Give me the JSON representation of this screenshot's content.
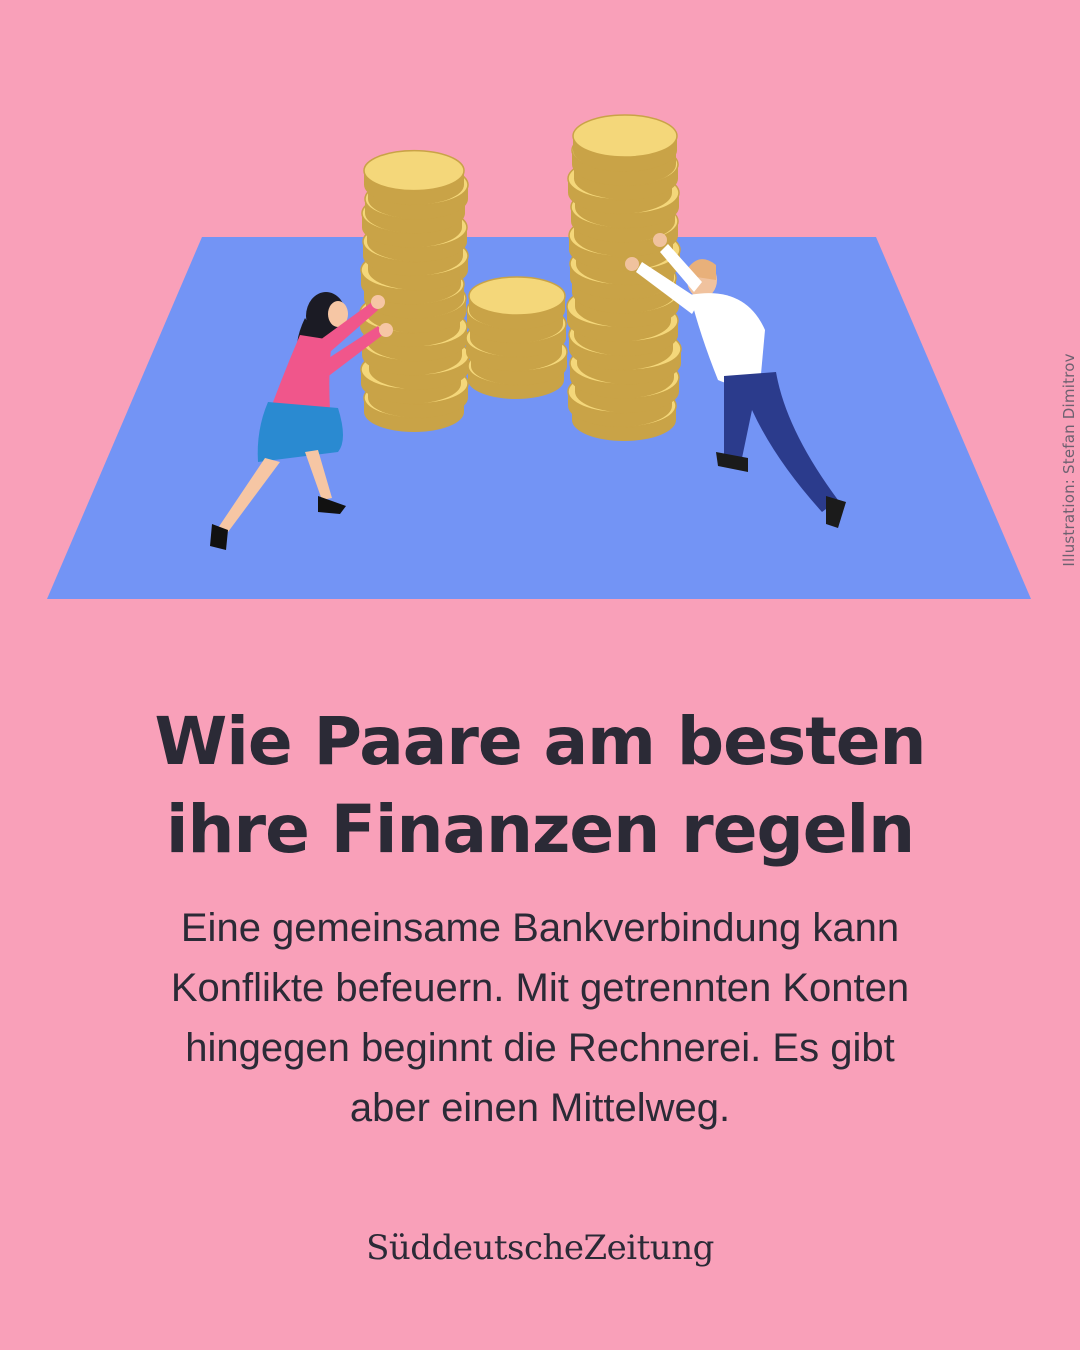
{
  "illustration": {
    "credit": "Illustration: Stefan Dimitrov",
    "scene": "two people pushing stacks of gold coins on a blue mat"
  },
  "article": {
    "headline_line1": "Wie Paare am besten",
    "headline_line2": "ihre Finanzen regeln",
    "teaser_line1": "Eine gemeinsame Bankverbindung kann",
    "teaser_line2": "Konflikte befeuern. Mit getrennten Konten",
    "teaser_line3": "hingegen beginnt die Rechnerei. Es gibt",
    "teaser_line4": "aber einen Mittelweg."
  },
  "brand": {
    "name": "SüddeutscheZeitung"
  },
  "colors": {
    "background": "#f9a0b9",
    "mat": "#7394f5",
    "coin": "#f4d77a",
    "coin_shadow": "#c9a347",
    "text": "#2b2a36"
  }
}
